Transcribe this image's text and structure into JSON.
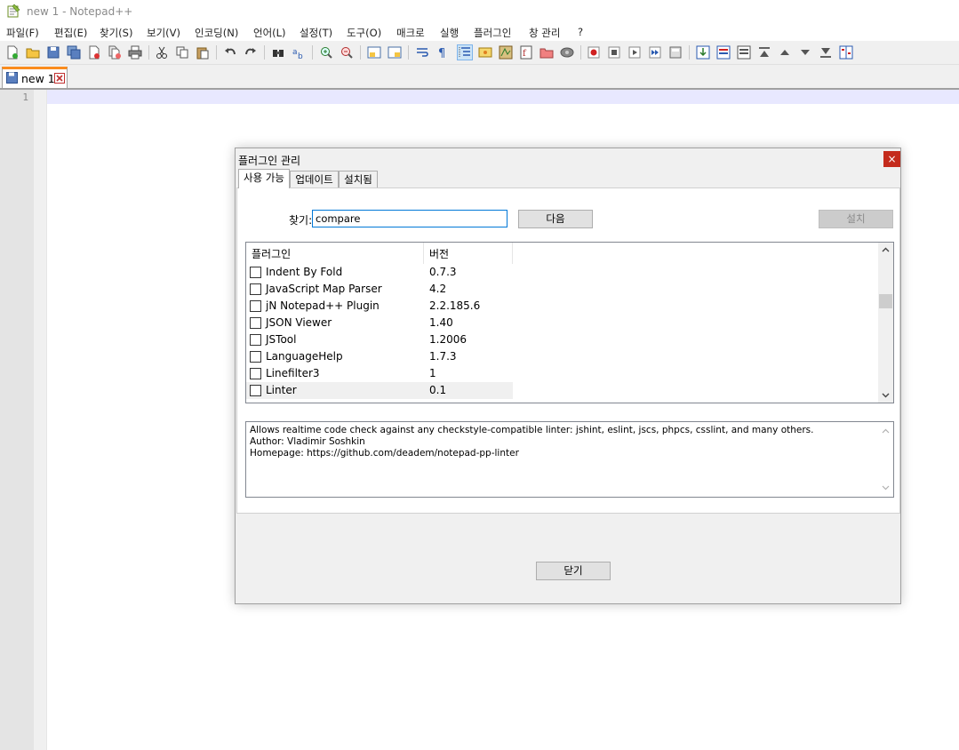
{
  "window": {
    "title": "new 1 - Notepad++"
  },
  "menu": [
    "파일(F)",
    "편집(E)",
    "찾기(S)",
    "보기(V)",
    "인코딩(N)",
    "언어(L)",
    "설정(T)",
    "도구(O)",
    "매크로",
    "실행",
    "플러그인",
    "창 관리",
    "?"
  ],
  "tab": {
    "label": "new 1"
  },
  "editor": {
    "line_number": "1"
  },
  "dialog": {
    "title": "플러그인 관리",
    "close_glyph": "×",
    "tabs": [
      "사용 가능",
      "업데이트",
      "설치됨"
    ],
    "search_label": "찾기:",
    "search_value": "compare",
    "next_button": "다음",
    "install_button": "설치",
    "columns": [
      "플러그인",
      "버전"
    ],
    "plugins": [
      {
        "name": "Indent By Fold",
        "version": "0.7.3"
      },
      {
        "name": "JavaScript Map Parser",
        "version": "4.2"
      },
      {
        "name": "jN Notepad++ Plugin",
        "version": "2.2.185.6"
      },
      {
        "name": "JSON Viewer",
        "version": "1.40"
      },
      {
        "name": "JSTool",
        "version": "1.2006"
      },
      {
        "name": "LanguageHelp",
        "version": "1.7.3"
      },
      {
        "name": "Linefilter3",
        "version": "1"
      },
      {
        "name": "Linter",
        "version": "0.1"
      }
    ],
    "description": [
      "Allows realtime code check against any checkstyle-compatible linter: jshint, eslint, jscs, phpcs, csslint, and many others.",
      "Author: Vladimir Soshkin",
      "Homepage: https://github.com/deadem/notepad-pp-linter"
    ],
    "close_button": "닫기"
  }
}
